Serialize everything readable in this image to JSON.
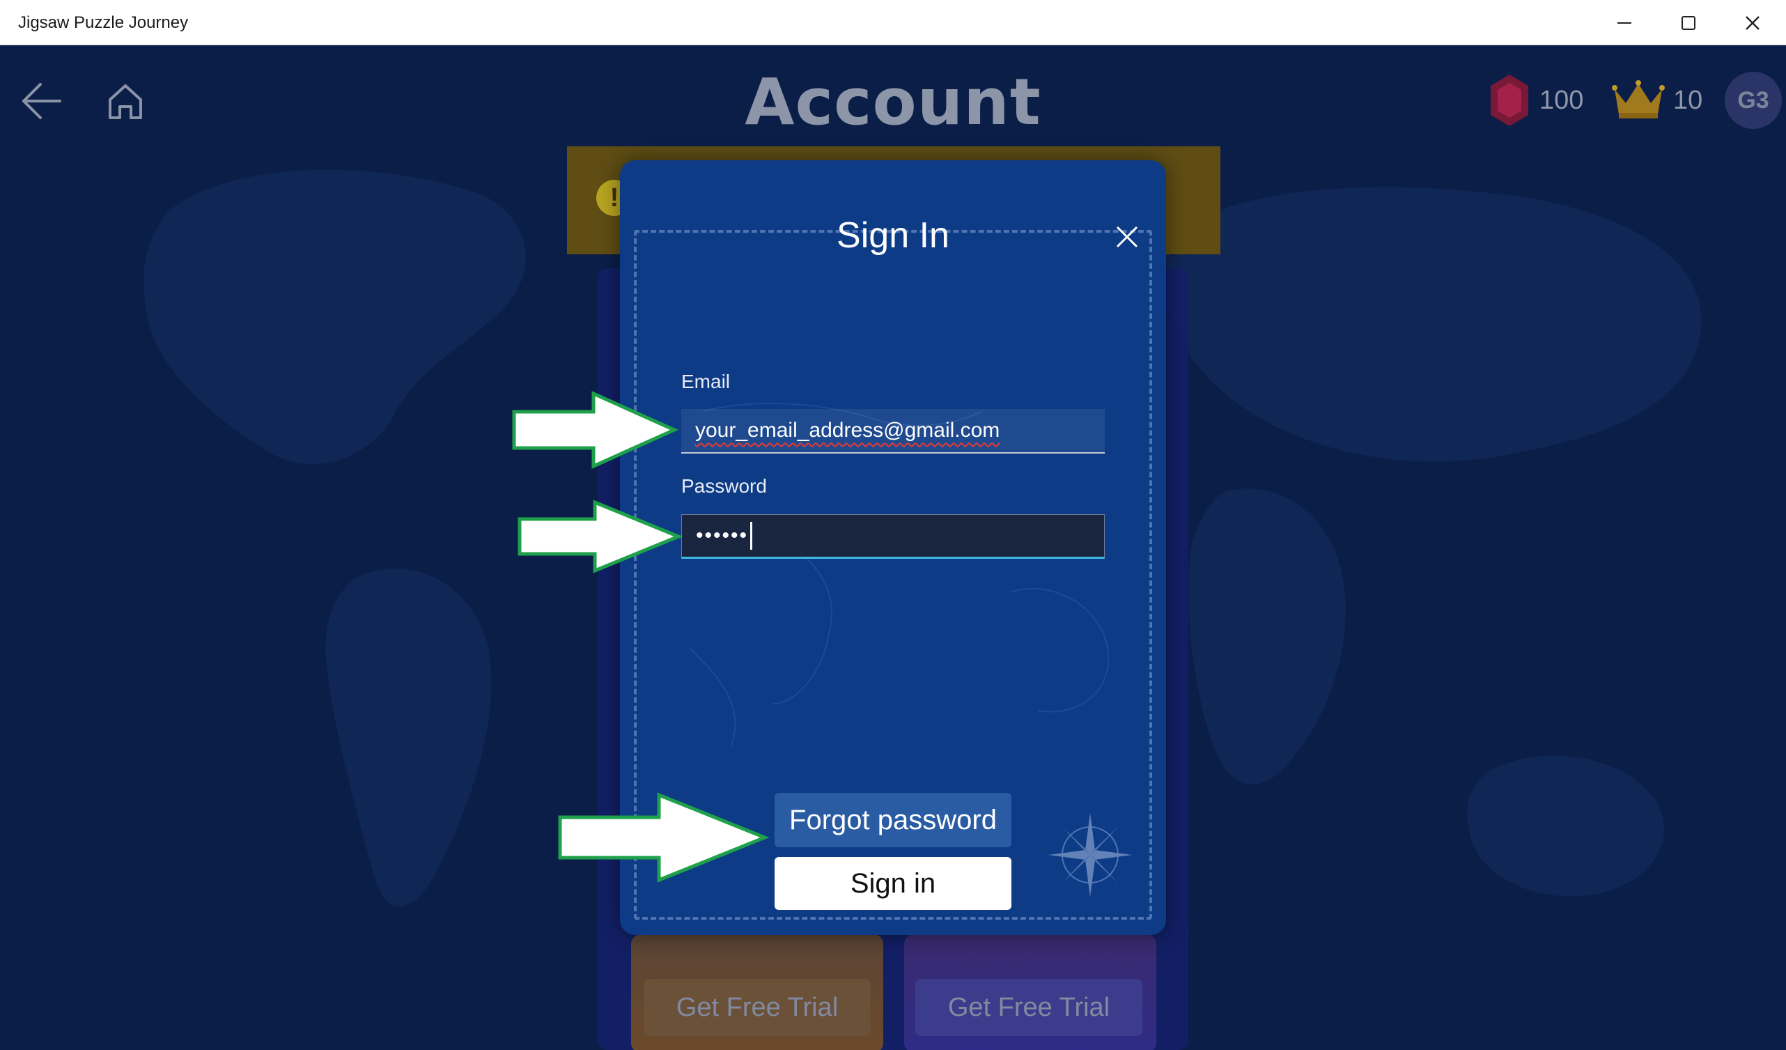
{
  "window": {
    "title": "Jigsaw Puzzle Journey",
    "controls": [
      "minimize-icon",
      "maximize-icon",
      "close-icon"
    ]
  },
  "header": {
    "back_icon": "back-arrow-icon",
    "home_icon": "home-icon",
    "title": "Account",
    "gems": "100",
    "crowns": "10",
    "avatar_initials": "G3"
  },
  "background": {
    "trial_buttons": [
      "Get Free Trial",
      "Get Free Trial"
    ]
  },
  "dialog": {
    "title": "Sign In",
    "email_label": "Email",
    "email_value": "your_email_address@gmail.com",
    "password_label": "Password",
    "password_value": "••••••",
    "forgot_label": "Forgot password",
    "signin_label": "Sign in"
  },
  "colors": {
    "app_bg": "#0b1e48",
    "dialog_bg": "#0d3b86",
    "arrow_fill": "#ffffff",
    "arrow_stroke": "#1fa04a",
    "focus_accent": "#3bbbe0"
  }
}
